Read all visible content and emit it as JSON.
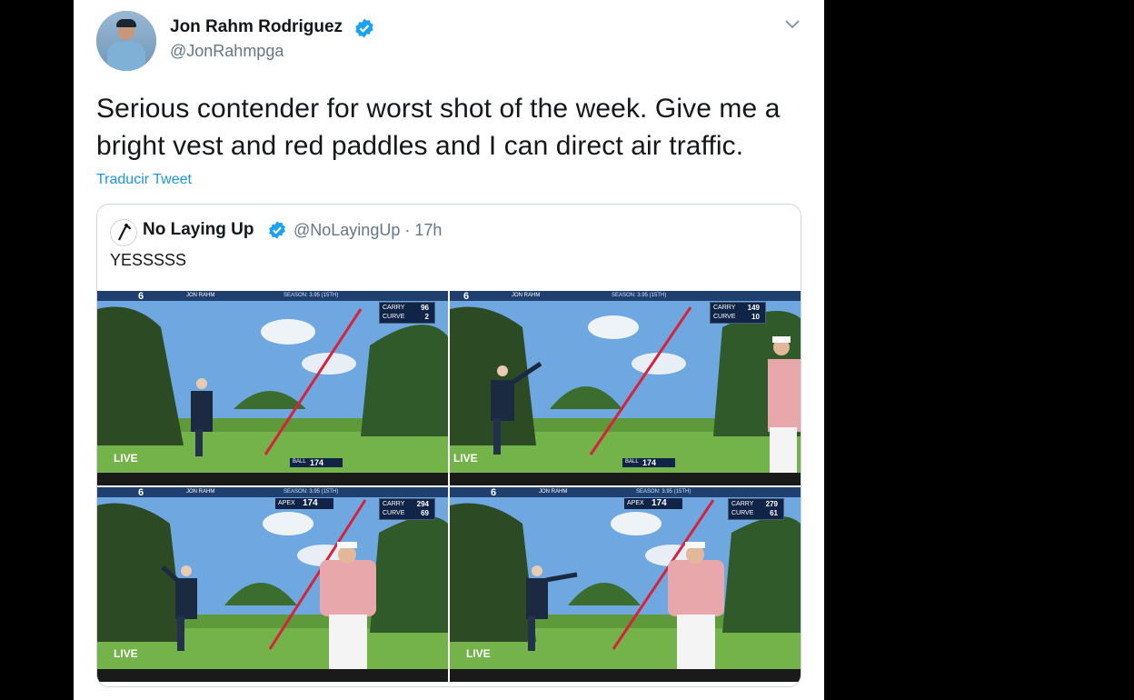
{
  "tweet": {
    "author_name": "Jon Rahm Rodriguez",
    "author_handle": "@JonRahmpga",
    "text_line1": "Serious contender for worst shot of the week. Give me a",
    "text_line2": "bright vest and red paddles and I can direct air traffic.",
    "translate_label": "Traducir Tweet"
  },
  "quoted": {
    "author_name": "No Laying Up",
    "author_handle": "@NoLayingUp · 17h",
    "text": "YESSSSS"
  },
  "broadcast": {
    "hole": "6",
    "player": "JON RAHM",
    "season": "SEASON: 3.95 (15TH)",
    "live": "LIVE",
    "ball_label": "BALL",
    "apex_label": "APEX",
    "carry_label": "CARRY",
    "curve_label": "CURVE",
    "panels": [
      {
        "carry": "96",
        "curve": "2",
        "apex": "",
        "ball": "174"
      },
      {
        "carry": "149",
        "curve": "10",
        "apex": "",
        "ball": "174"
      },
      {
        "carry": "294",
        "curve": "69",
        "apex": "174",
        "ball": ""
      },
      {
        "carry": "279",
        "curve": "61",
        "apex": "174",
        "ball": ""
      }
    ]
  },
  "colors": {
    "link": "#1b95e0",
    "verified": "#1da1f2",
    "text": "#14171a",
    "secondary": "#657786",
    "tracer": "#d6223a"
  },
  "icons": [
    "verified-badge-icon",
    "chevron-down-icon",
    "play-icon",
    "volume-icon"
  ]
}
